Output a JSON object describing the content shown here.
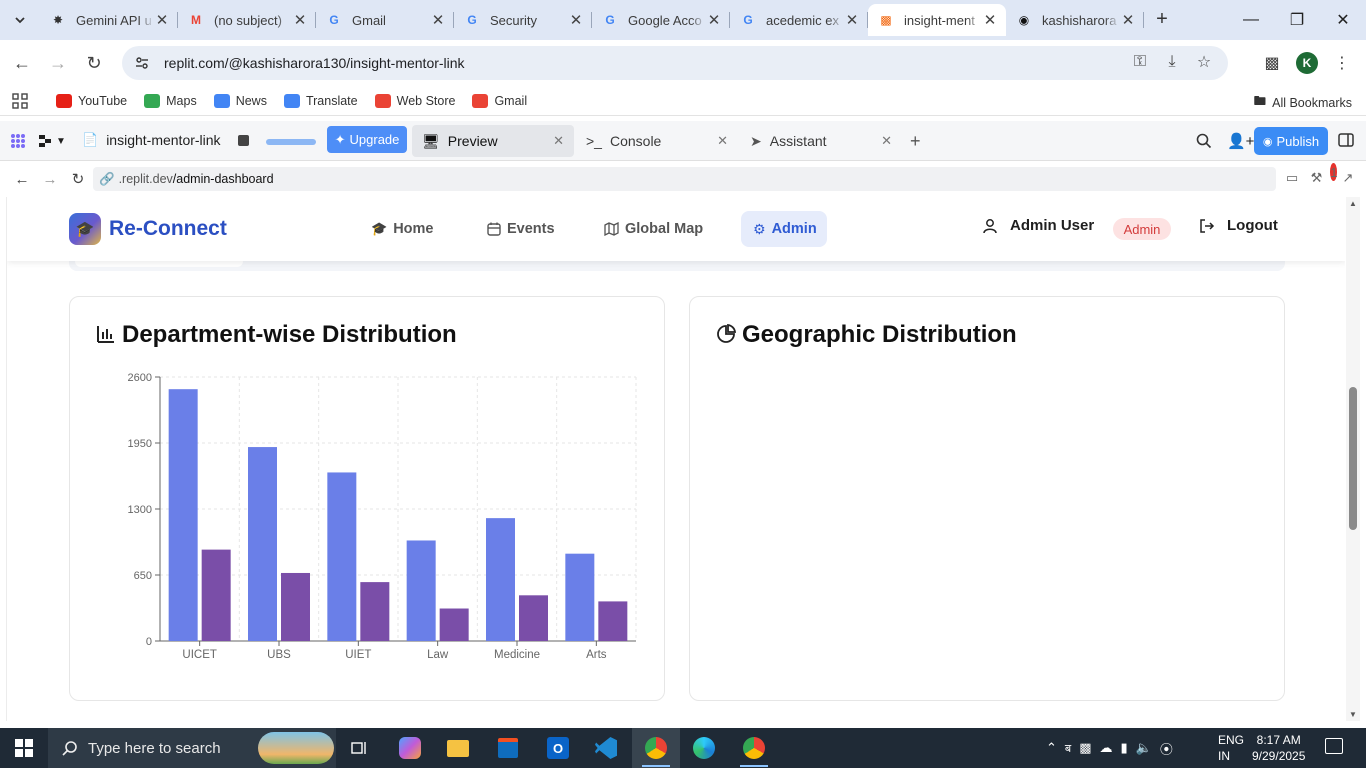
{
  "browser": {
    "tabs": [
      {
        "title": "Gemini API u",
        "icon": "gemini-icon",
        "active": false
      },
      {
        "title": "(no subject)",
        "icon": "gmail-icon",
        "active": false
      },
      {
        "title": "Gmail",
        "icon": "google-icon",
        "active": false
      },
      {
        "title": "Security",
        "icon": "google-icon",
        "active": false
      },
      {
        "title": "Google Acco",
        "icon": "google-icon",
        "active": false
      },
      {
        "title": "acedemic ex",
        "icon": "google-icon",
        "active": false
      },
      {
        "title": "insight-ment",
        "icon": "replit-icon",
        "active": true
      },
      {
        "title": "kashisharora",
        "icon": "github-icon",
        "active": false
      }
    ],
    "address": "replit.com/@kashisharora130/insight-mentor-link",
    "bookmarks": [
      {
        "label": "YouTube",
        "color": "#e62117"
      },
      {
        "label": "Maps",
        "color": "#34a853"
      },
      {
        "label": "News",
        "color": "#4285f4"
      },
      {
        "label": "Translate",
        "color": "#4285f4"
      },
      {
        "label": "Web Store",
        "color": "#ea4335"
      },
      {
        "label": "Gmail",
        "color": "#ea4335"
      }
    ],
    "all_bookmarks": "All Bookmarks",
    "profile_initial": "K"
  },
  "replit": {
    "project_name": "insight-mentor-link",
    "upgrade_label": "Upgrade",
    "tabs": [
      {
        "label": "Preview",
        "icon": "monitor-icon"
      },
      {
        "label": "Console",
        "icon": "terminal-icon"
      },
      {
        "label": "Assistant",
        "icon": "assistant-icon"
      }
    ],
    "publish_label": "Publish",
    "preview_url_prefix": ".replit.dev",
    "preview_url_path": "/admin-dashboard",
    "notification_count": "1"
  },
  "app": {
    "brand": "Re-Connect",
    "nav": [
      {
        "label": "Home",
        "icon": "graduation-cap-icon"
      },
      {
        "label": "Events",
        "icon": "calendar-icon"
      },
      {
        "label": "Global Map",
        "icon": "map-icon"
      },
      {
        "label": "Admin",
        "icon": "gear-icon"
      }
    ],
    "user_name": "Admin User",
    "role_badge": "Admin",
    "logout_label": "Logout",
    "cards": [
      {
        "title": "Department-wise Distribution",
        "icon": "bar-chart-icon"
      },
      {
        "title": "Geographic Distribution",
        "icon": "pie-chart-icon"
      }
    ]
  },
  "chart_data": {
    "type": "bar",
    "title": "Department-wise Distribution",
    "categories": [
      "UICET",
      "UBS",
      "UIET",
      "Law",
      "Medicine",
      "Arts"
    ],
    "series": [
      {
        "values": [
          2480,
          1910,
          1660,
          990,
          1210,
          860
        ],
        "color": "#6a7fe8"
      },
      {
        "values": [
          900,
          670,
          580,
          320,
          450,
          390
        ],
        "color": "#7a4ea8"
      }
    ],
    "yticks": [
      "0",
      "650",
      "1300",
      "1950",
      "2600"
    ],
    "ylim": [
      0,
      2600
    ],
    "grid": true
  },
  "taskbar": {
    "search_placeholder": "Type here to search",
    "lang_line1": "ENG",
    "lang_line2": "IN",
    "time": "8:17 AM",
    "date": "9/29/2025"
  }
}
